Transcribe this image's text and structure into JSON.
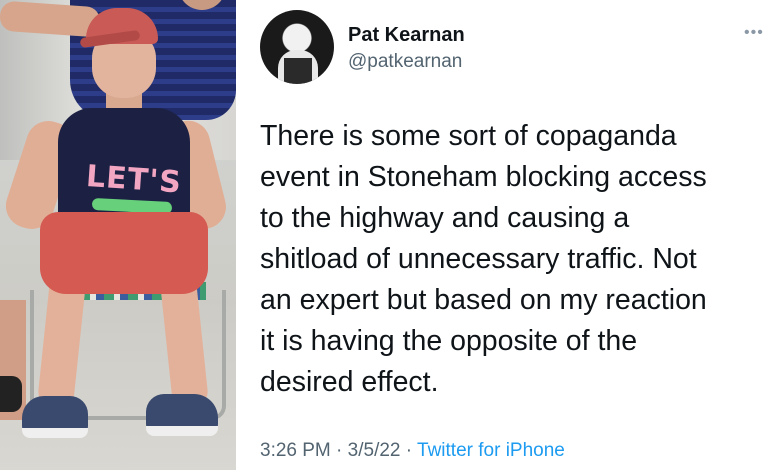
{
  "tweet": {
    "author_name": "Pat Kearnan",
    "author_handle": "@patkearnan",
    "more_icon": "more-horizontal-icon",
    "text_lines": [
      "There is some sort of copaganda",
      "event in Stoneham blocking access",
      "to the highway and causing a",
      "shitload of unnecessary traffic. Not",
      "an expert but based on my reaction",
      "it is having the opposite of the",
      "desired effect."
    ],
    "time": "3:26 PM",
    "date": "3/5/22",
    "separator": "·",
    "source": "Twitter for iPhone"
  },
  "photo": {
    "shirt_text": "LET'S"
  },
  "colors": {
    "text": "#0f1419",
    "secondary": "#536471",
    "link": "#1d9bf0"
  }
}
